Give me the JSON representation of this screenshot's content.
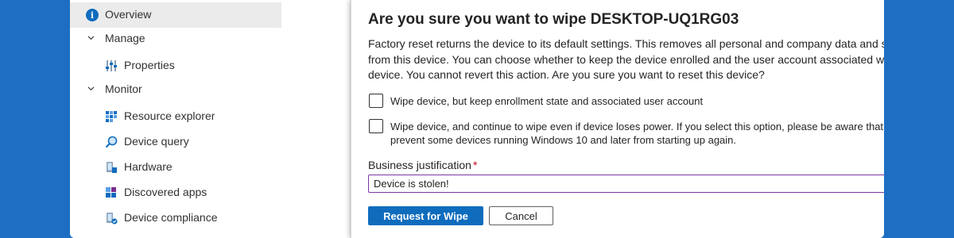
{
  "nav": {
    "items": [
      {
        "label": "Overview",
        "icon": "info-icon"
      },
      {
        "label": "Manage",
        "icon": "chevron-down-icon"
      },
      {
        "label": "Properties",
        "icon": "properties-icon"
      },
      {
        "label": "Monitor",
        "icon": "chevron-down-icon"
      },
      {
        "label": "Resource explorer",
        "icon": "resource-explorer-icon"
      },
      {
        "label": "Device query",
        "icon": "device-query-icon"
      },
      {
        "label": "Hardware",
        "icon": "hardware-icon"
      },
      {
        "label": "Discovered apps",
        "icon": "discovered-apps-icon"
      },
      {
        "label": "Device compliance",
        "icon": "device-compliance-icon"
      }
    ]
  },
  "dialog": {
    "title": "Are you sure you want to wipe DESKTOP-UQ1RG03",
    "description": "Factory reset returns the device to its default settings. This removes all personal and company data and settings from this device. You can choose whether to keep the device enrolled and the user account associated with this device. You cannot revert this action. Are you sure you want to reset this device?",
    "options": [
      {
        "label": "Wipe device, but keep enrollment state and associated user account",
        "checked": false
      },
      {
        "label": "Wipe device, and continue to wipe even if device loses power. If you select this option, please be aware that it might prevent some devices running Windows 10 and later from starting up again.",
        "checked": false
      }
    ],
    "justification": {
      "label": "Business justification",
      "required_mark": "*",
      "value": "Device is stolen!"
    },
    "buttons": {
      "primary": "Request for Wipe",
      "secondary": "Cancel"
    }
  },
  "colors": {
    "accent": "#0f6cbd",
    "background": "#1e6fc4",
    "input_border": "#7c37a4",
    "required": "#c50f1f",
    "valid_check": "#6bb700"
  }
}
